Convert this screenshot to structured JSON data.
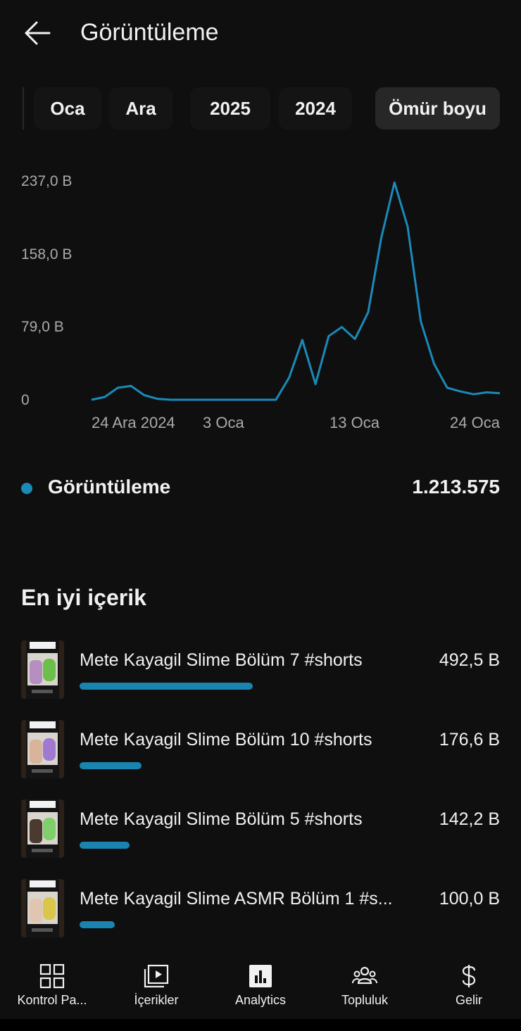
{
  "header": {
    "title": "Görüntüleme"
  },
  "periods": [
    "Oca",
    "Ara",
    "2025",
    "2024",
    "Ömür boyu"
  ],
  "selected_period": "Ömür boyu",
  "chart_data": {
    "type": "line",
    "y_ticks": [
      "237,0 B",
      "158,0 B",
      "79,0 B",
      "0"
    ],
    "x_ticks": [
      "24 Ara 2024",
      "3 Oca",
      "13 Oca",
      "24 Oca"
    ],
    "ylim": [
      0,
      237000
    ],
    "grid": false,
    "series": [
      {
        "color": "#1a8ab8",
        "values": [
          0,
          3000,
          13000,
          15000,
          5000,
          1000,
          0,
          0,
          0,
          0,
          0,
          0,
          0,
          0,
          0,
          24000,
          65000,
          17000,
          69000,
          79000,
          66000,
          95000,
          176000,
          236000,
          188000,
          85000,
          39000,
          13000,
          9000,
          6000,
          8000,
          7000
        ]
      }
    ]
  },
  "legend": {
    "label": "Görüntüleme",
    "value": "1.213.575",
    "color": "#1a8ab8"
  },
  "top_content": {
    "title": "En iyi içerik",
    "items": [
      {
        "title": "Mete Kayagil Slime Bölüm 7 #shorts",
        "value": "492,5 B",
        "share": 1.0,
        "face": "#b68fc0",
        "object": "#6bbf4a"
      },
      {
        "title": "Mete Kayagil Slime Bölüm 10 #shorts",
        "value": "176,6 B",
        "share": 0.359,
        "face": "#d8b49a",
        "object": "#9f7ad0"
      },
      {
        "title": "Mete Kayagil Slime Bölüm 5 #shorts",
        "value": "142,2 B",
        "share": 0.289,
        "face": "#4a3a30",
        "object": "#7fcf6a"
      },
      {
        "title": "Mete Kayagil Slime ASMR Bölüm 1 #s...",
        "value": "100,0 B",
        "share": 0.203,
        "face": "#e0c6b0",
        "object": "#d9c64a"
      }
    ]
  },
  "nav": {
    "items": [
      {
        "label": "Kontrol Pa...",
        "icon": "dashboard-icon"
      },
      {
        "label": "İçerikler",
        "icon": "content-icon"
      },
      {
        "label": "Analytics",
        "icon": "analytics-icon"
      },
      {
        "label": "Topluluk",
        "icon": "community-icon"
      },
      {
        "label": "Gelir",
        "icon": "dollar-icon"
      }
    ]
  }
}
